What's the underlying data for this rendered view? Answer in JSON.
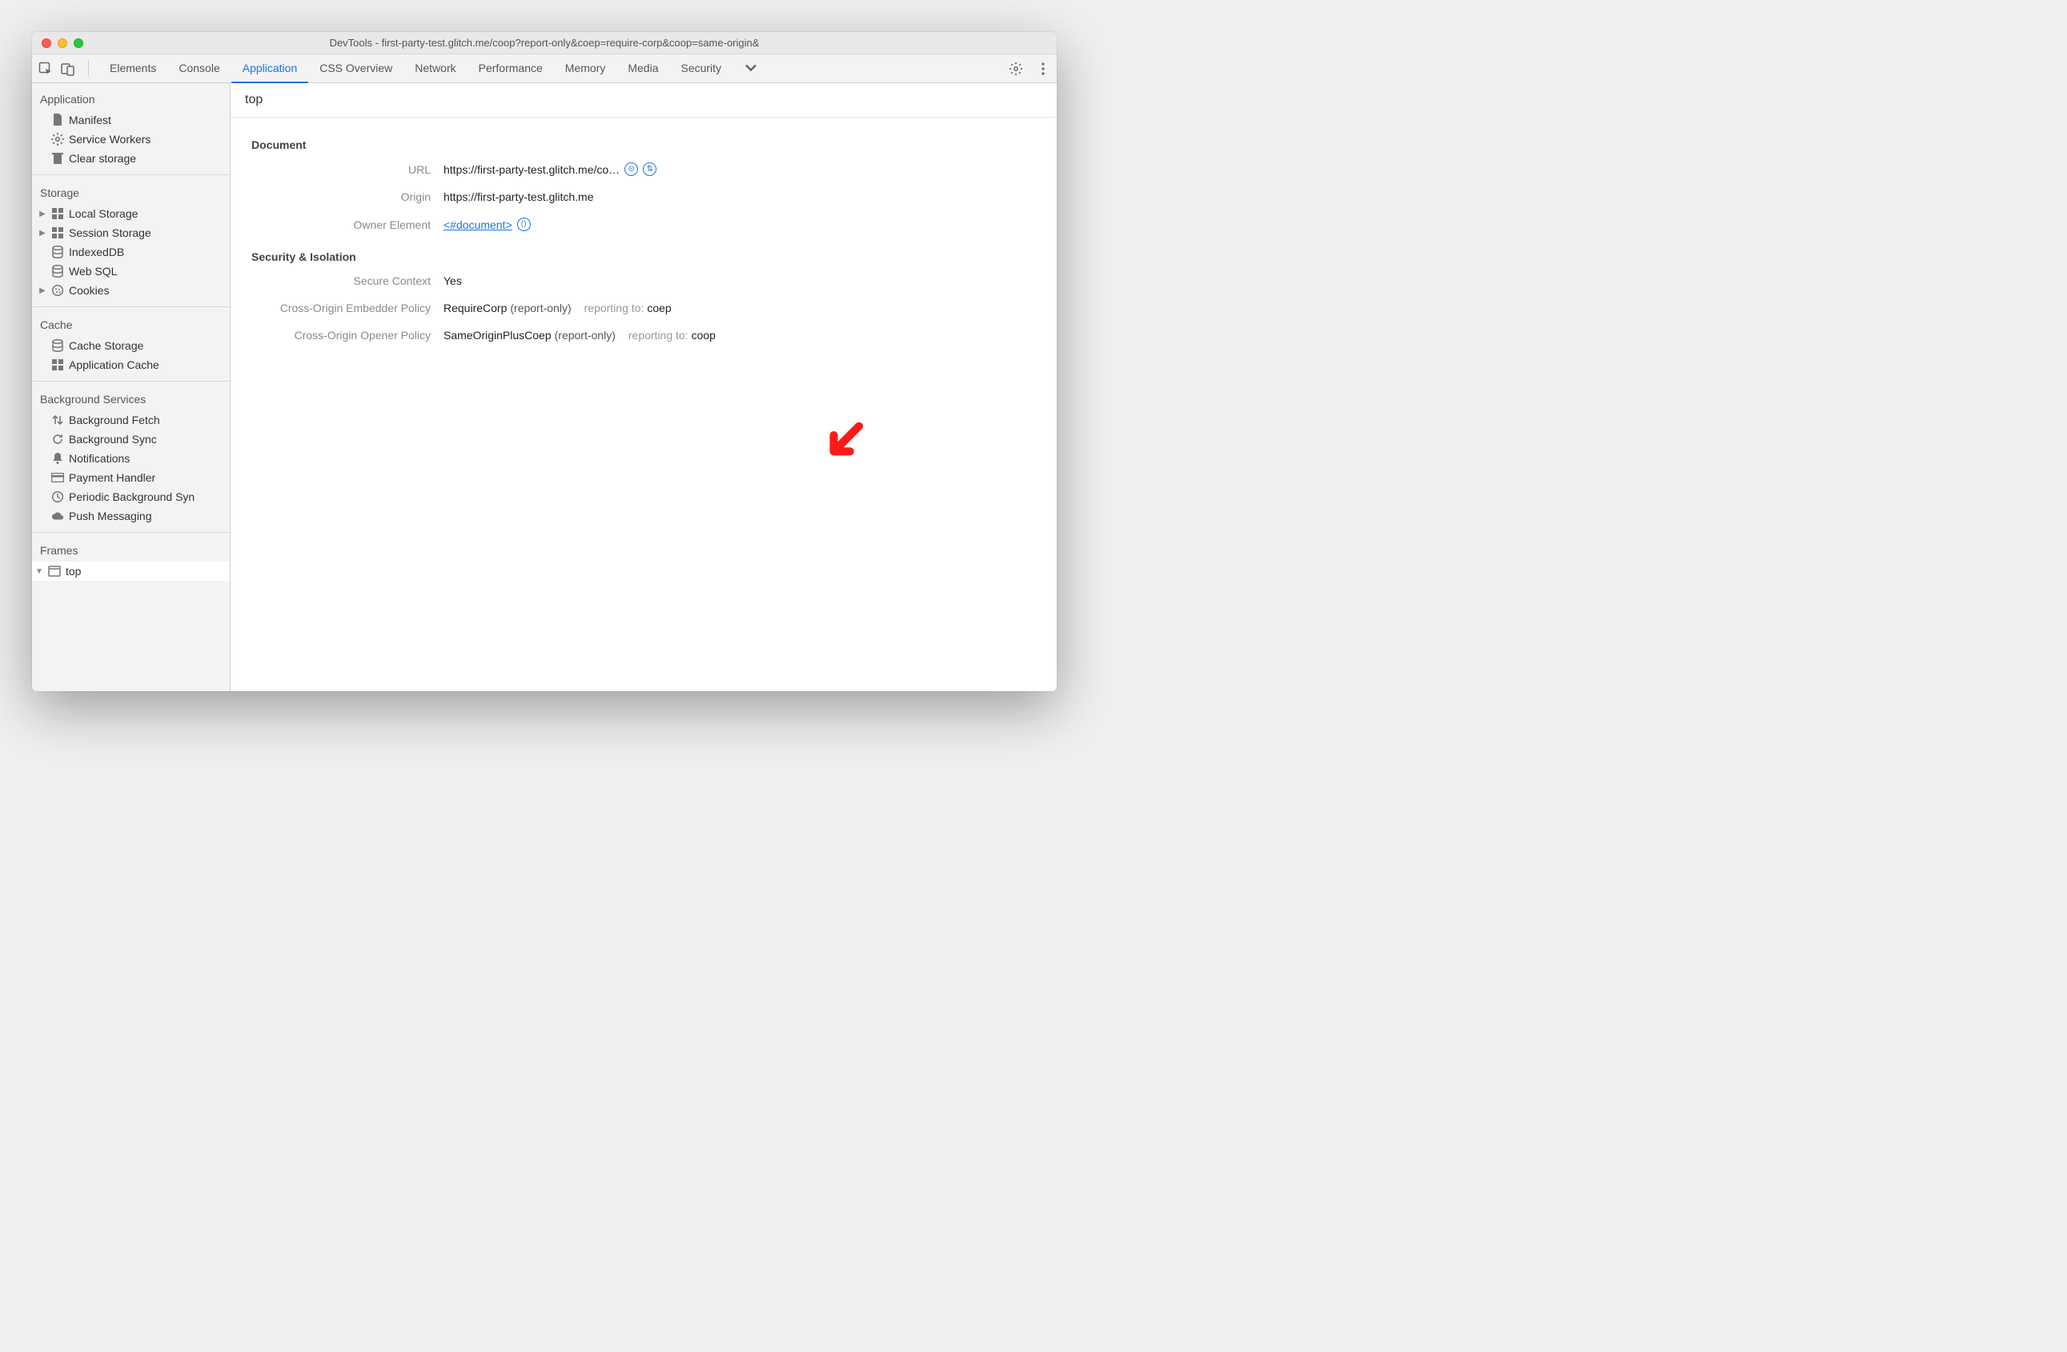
{
  "window": {
    "title": "DevTools - first-party-test.glitch.me/coop?report-only&coep=require-corp&coop=same-origin&"
  },
  "tabs": [
    "Elements",
    "Console",
    "Application",
    "CSS Overview",
    "Network",
    "Performance",
    "Memory",
    "Media",
    "Security"
  ],
  "active_tab": "Application",
  "sidebar": {
    "sections": [
      {
        "title": "Application",
        "items": [
          {
            "icon": "document",
            "label": "Manifest"
          },
          {
            "icon": "gear",
            "label": "Service Workers"
          },
          {
            "icon": "trash",
            "label": "Clear storage"
          }
        ]
      },
      {
        "title": "Storage",
        "items": [
          {
            "icon": "grid",
            "label": "Local Storage",
            "expandable": true
          },
          {
            "icon": "grid",
            "label": "Session Storage",
            "expandable": true
          },
          {
            "icon": "db",
            "label": "IndexedDB"
          },
          {
            "icon": "db",
            "label": "Web SQL"
          },
          {
            "icon": "cookie",
            "label": "Cookies",
            "expandable": true
          }
        ]
      },
      {
        "title": "Cache",
        "items": [
          {
            "icon": "db",
            "label": "Cache Storage"
          },
          {
            "icon": "grid",
            "label": "Application Cache"
          }
        ]
      },
      {
        "title": "Background Services",
        "items": [
          {
            "icon": "updown",
            "label": "Background Fetch"
          },
          {
            "icon": "sync",
            "label": "Background Sync"
          },
          {
            "icon": "bell",
            "label": "Notifications"
          },
          {
            "icon": "card",
            "label": "Payment Handler"
          },
          {
            "icon": "clock",
            "label": "Periodic Background Syn"
          },
          {
            "icon": "cloud",
            "label": "Push Messaging"
          }
        ]
      },
      {
        "title": "Frames",
        "items": [
          {
            "icon": "frame",
            "label": "top",
            "expandable": true,
            "expanded": true,
            "selected": true
          }
        ]
      }
    ]
  },
  "page": {
    "title": "top",
    "document": {
      "heading": "Document",
      "url_label": "URL",
      "url_value": "https://first-party-test.glitch.me/co…",
      "origin_label": "Origin",
      "origin_value": "https://first-party-test.glitch.me",
      "owner_label": "Owner Element",
      "owner_value": "<#document>"
    },
    "security": {
      "heading": "Security & Isolation",
      "secure_label": "Secure Context",
      "secure_value": "Yes",
      "coep_label": "Cross-Origin Embedder Policy",
      "coep_value": "RequireCorp",
      "coep_mode": "(report-only)",
      "coep_reporting_label": "reporting to:",
      "coep_reporting_value": "coep",
      "coop_label": "Cross-Origin Opener Policy",
      "coop_value": "SameOriginPlusCoep",
      "coop_mode": "(report-only)",
      "coop_reporting_label": "reporting to:",
      "coop_reporting_value": "coop"
    }
  }
}
